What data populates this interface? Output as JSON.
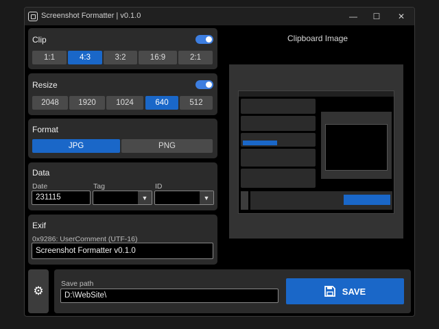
{
  "window": {
    "title": "Screenshot Formatter | v0.1.0",
    "minimize": "—",
    "maximize": "☐",
    "close": "✕"
  },
  "clip": {
    "label": "Clip",
    "enabled": true,
    "options": [
      "1:1",
      "4:3",
      "3:2",
      "16:9",
      "2:1"
    ],
    "selected": "4:3"
  },
  "resize": {
    "label": "Resize",
    "enabled": true,
    "options": [
      "2048",
      "1920",
      "1024",
      "640",
      "512"
    ],
    "selected": "640"
  },
  "format": {
    "label": "Format",
    "options": [
      "JPG",
      "PNG"
    ],
    "selected": "JPG"
  },
  "data": {
    "label": "Data",
    "date_label": "Date",
    "date_value": "231115",
    "tag_label": "Tag",
    "tag_value": "",
    "id_label": "ID",
    "id_value": ""
  },
  "exif": {
    "label": "Exif",
    "field_label": "0x9286: UserComment (UTF-16)",
    "value": "Screenshot Formatter v0.1.0"
  },
  "preview": {
    "title": "Clipboard Image"
  },
  "save": {
    "path_label": "Save path",
    "path_value": "D:\\WebSite\\",
    "button_label": "SAVE"
  },
  "colors": {
    "accent": "#1a67c8",
    "panel": "#2b2b2b",
    "background": "#000000"
  },
  "icons": {
    "app": "app-icon",
    "settings": "gear-icon",
    "save": "floppy-disk-icon",
    "dropdown": "chevron-down-icon"
  }
}
